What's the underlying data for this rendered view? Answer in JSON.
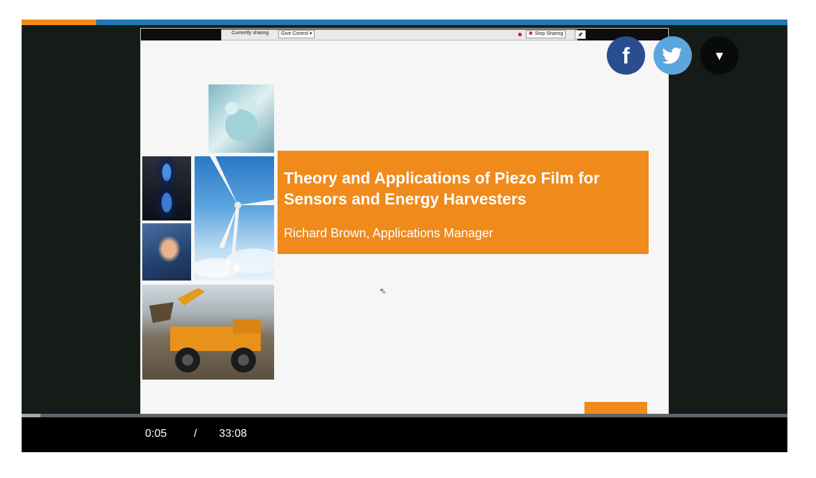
{
  "player": {
    "progress_top": 0.097,
    "scrub_progress": 0.025,
    "time": {
      "current": "0:05",
      "separator": "/",
      "total": "33:08"
    }
  },
  "share_bar": {
    "currently_sharing": "Currently sharing",
    "give_control": "Give Control ▾",
    "stop_sharing": "Stop Sharing",
    "pin_glyph": "🖈"
  },
  "slide": {
    "title": "Theory and Applications of Piezo Film for Sensors and Energy Harvesters",
    "subtitle": "Richard Brown, Applications Manager"
  },
  "social": {
    "facebook_glyph": "f",
    "more_glyph": "▼"
  },
  "colors": {
    "accent_orange": "#ef8a1b",
    "progress_blue": "#1f78b4",
    "facebook_blue": "#2a4d8f",
    "twitter_blue": "#5da6dd"
  },
  "icons": [
    "facebook-icon",
    "twitter-icon",
    "chevron-down-icon",
    "pin-icon",
    "close-icon",
    "mouse-cursor-icon"
  ]
}
